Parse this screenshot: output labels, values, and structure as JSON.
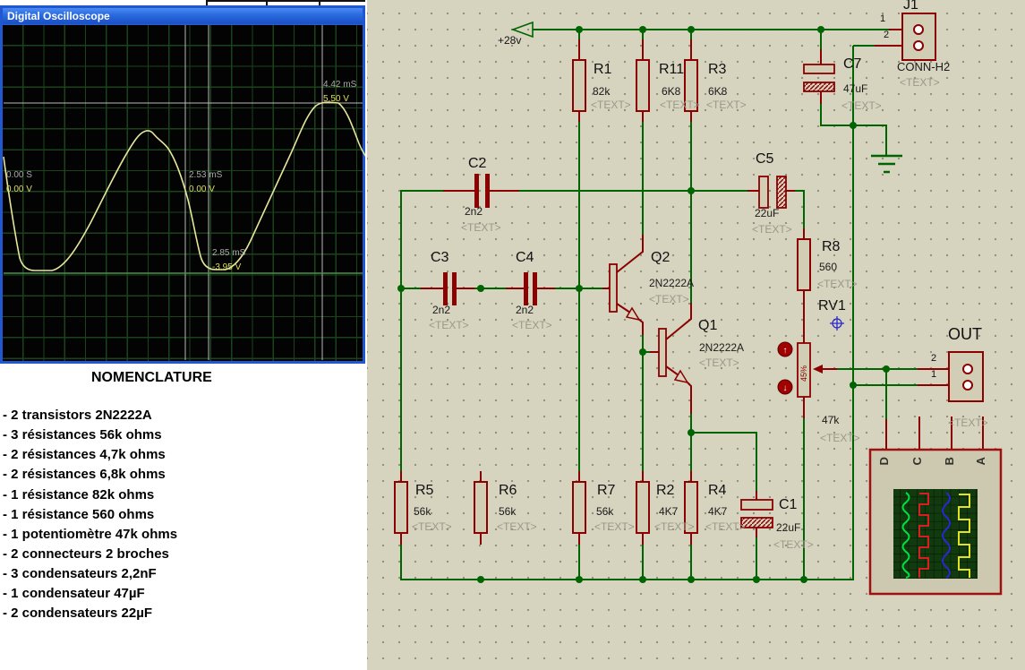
{
  "window": {
    "title": "Digital Oscilloscope"
  },
  "scope": {
    "markers": [
      {
        "time": "0.00 S",
        "volt": "0.00 V"
      },
      {
        "time": "2.53 mS",
        "volt": "0.00 V"
      },
      {
        "time": "2.85 mS",
        "volt": "-3.95 V"
      },
      {
        "time": "4.42 mS",
        "volt": "5.50 V"
      }
    ]
  },
  "nomenclature": {
    "title": "NOMENCLATURE",
    "items": [
      "- 2 transistors 2N2222A",
      "- 3 résistances 56k ohms",
      "- 2 résistances 4,7k ohms",
      "- 2 résistances 6,8k ohms",
      "- 1 résistance 82k ohms",
      "- 1 résistance 560 ohms",
      "- 1 potentiomètre 47k ohms",
      "- 2 connecteurs 2 broches",
      "- 3 condensateurs 2,2nF",
      "- 1 condensateur 47µF",
      "- 2 condensateurs 22µF"
    ]
  },
  "schematic": {
    "power_label": "+28v",
    "resistors": [
      {
        "ref": "R1",
        "value": "82k",
        "text": "<TEXT>"
      },
      {
        "ref": "R11",
        "value": "6K8",
        "text": "<TEXT>"
      },
      {
        "ref": "R3",
        "value": "6K8",
        "text": "<TEXT>"
      },
      {
        "ref": "R5",
        "value": "56k",
        "text": "<TEXT>"
      },
      {
        "ref": "R6",
        "value": "56k",
        "text": "<TEXT>"
      },
      {
        "ref": "R7",
        "value": "56k",
        "text": "<TEXT>"
      },
      {
        "ref": "R2",
        "value": "4K7",
        "text": "<TEXT>"
      },
      {
        "ref": "R4",
        "value": "4K7",
        "text": "<TEXT>"
      },
      {
        "ref": "R8",
        "value": "560",
        "text": "<TEXT>"
      }
    ],
    "capacitors": [
      {
        "ref": "C2",
        "value": "2n2",
        "text": "<TEXT>"
      },
      {
        "ref": "C3",
        "value": "2n2",
        "text": "<TEXT>"
      },
      {
        "ref": "C4",
        "value": "2n2",
        "text": "<TEXT>"
      },
      {
        "ref": "C5",
        "value": "22uF",
        "text": "<TEXT>"
      },
      {
        "ref": "C7",
        "value": "47uF",
        "text": "<TEXT>"
      },
      {
        "ref": "C1",
        "value": "22uF",
        "text": "<TEXT>"
      }
    ],
    "transistors": [
      {
        "ref": "Q2",
        "value": "2N2222A",
        "text": "<TEXT>"
      },
      {
        "ref": "Q1",
        "value": "2N2222A",
        "text": "<TEXT>"
      }
    ],
    "potentiometer": {
      "ref": "RV1",
      "value": "47k",
      "setting": "45%",
      "text": "<TEXT>",
      "increase_icon": "↑",
      "decrease_icon": "↓"
    },
    "connector_j1": {
      "ref": "J1",
      "part": "CONN-H2",
      "text": "<TEXT>",
      "pin1": "1",
      "pin2": "2"
    },
    "connector_out": {
      "ref": "OUT",
      "text": "<TEXT>",
      "pin2": "2",
      "pin1": "1"
    },
    "instrument": {
      "channels": [
        "D",
        "C",
        "B",
        "A"
      ]
    },
    "colors": {
      "wire": "#006400",
      "component": "#8b0000",
      "origin_marker": "#2929cc",
      "trace_yellow": "#e6e69a",
      "xp_titlebar": "#2a6ae0"
    }
  }
}
